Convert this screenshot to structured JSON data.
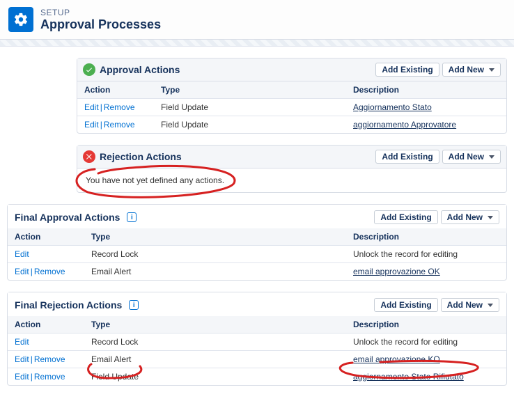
{
  "header": {
    "setup": "SETUP",
    "title": "Approval Processes"
  },
  "buttons": {
    "add_existing": "Add Existing",
    "add_new": "Add New"
  },
  "columns": {
    "action": "Action",
    "type": "Type",
    "description": "Description"
  },
  "links": {
    "edit": "Edit",
    "remove": "Remove"
  },
  "approval": {
    "title": "Approval Actions",
    "rows": [
      {
        "type": "Field Update",
        "desc": "Aggiornamento Stato"
      },
      {
        "type": "Field Update",
        "desc": "aggiornamento Approvatore"
      }
    ]
  },
  "rejection": {
    "title": "Rejection Actions",
    "empty": "You have not yet defined any actions."
  },
  "final_approval": {
    "title": "Final Approval Actions",
    "rows": [
      {
        "action_kind": "edit_only",
        "type": "Record Lock",
        "desc_kind": "text",
        "desc": "Unlock the record for editing"
      },
      {
        "action_kind": "edit_remove",
        "type": "Email Alert",
        "desc_kind": "link",
        "desc": "email approvazione OK"
      }
    ]
  },
  "final_rejection": {
    "title": "Final Rejection Actions",
    "rows": [
      {
        "action_kind": "edit_only",
        "type": "Record Lock",
        "desc_kind": "text",
        "desc": "Unlock the record for editing"
      },
      {
        "action_kind": "edit_remove",
        "type": "Email Alert",
        "desc_kind": "link",
        "desc": "email approvazione KO"
      },
      {
        "action_kind": "edit_remove",
        "type": "Field Update",
        "desc_kind": "link",
        "desc": "aggiornamento Stato Rifiutato"
      }
    ]
  }
}
